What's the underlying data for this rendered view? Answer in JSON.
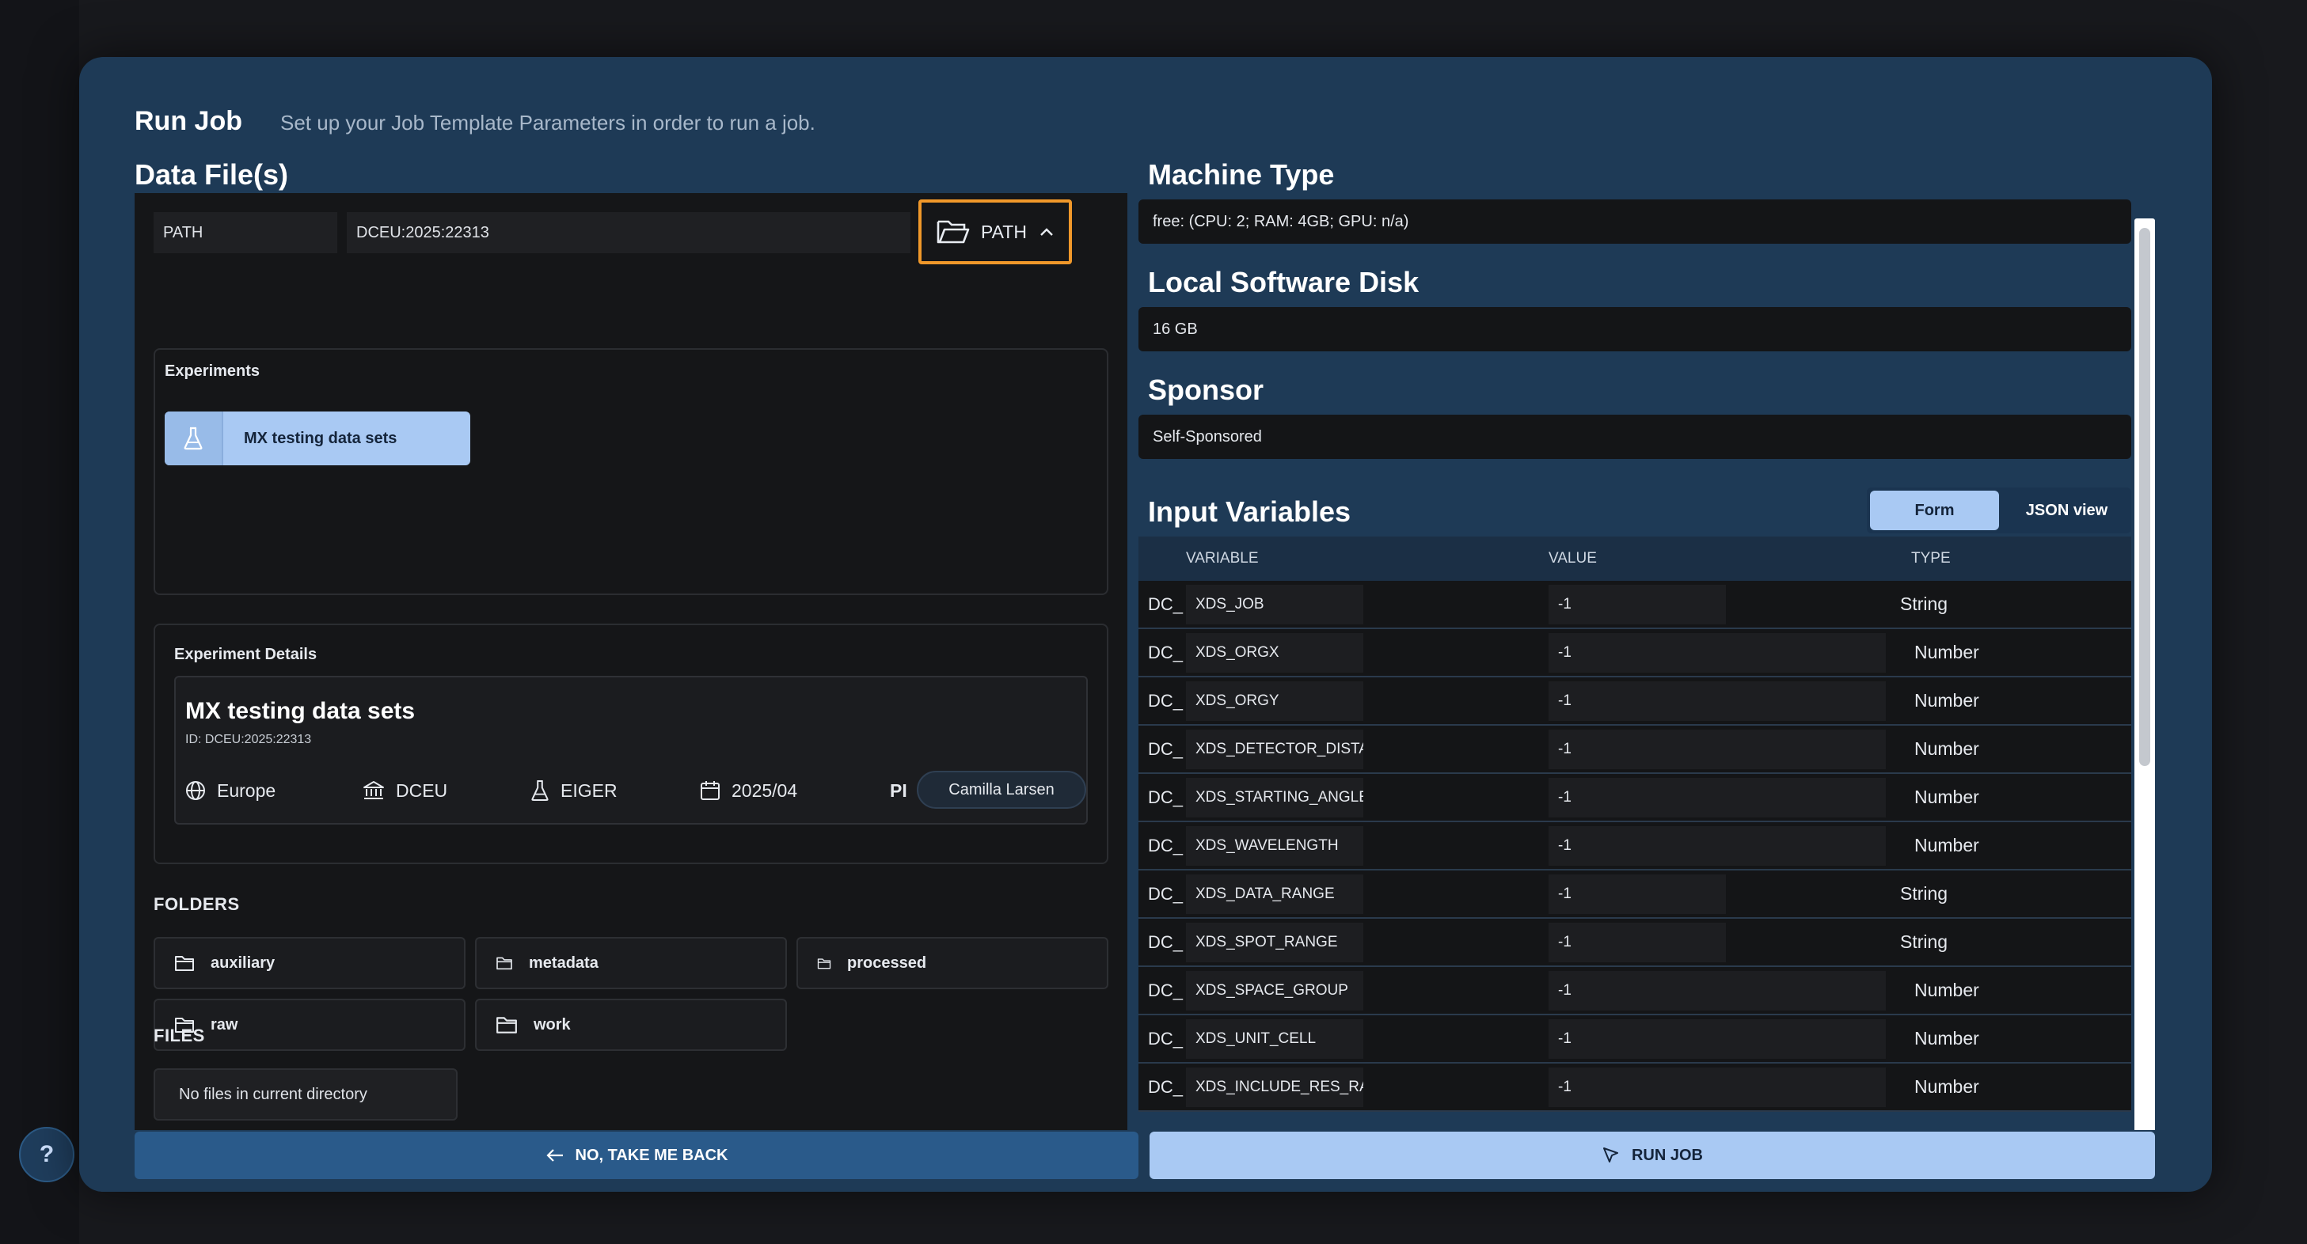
{
  "modal": {
    "title": "Run Job",
    "subtitle": "Set up your Job Template Parameters in order to run a job."
  },
  "data_files": {
    "heading": "Data File(s)",
    "path_label": "PATH",
    "path_value": "DCEU:2025:22313",
    "path_button_label": "PATH",
    "experiments": {
      "title": "Experiments",
      "items": [
        {
          "label": "MX testing data sets"
        }
      ]
    },
    "experiment_details": {
      "title": "Experiment Details",
      "name": "MX testing data sets",
      "id_text": "ID: DCEU:2025:22313",
      "region": "Europe",
      "facility": "DCEU",
      "instrument": "EIGER",
      "date": "2025/04",
      "pi_label": "PI",
      "pi_name": "Camilla Larsen"
    },
    "folders_heading": "FOLDERS",
    "folders": [
      {
        "label": "auxiliary"
      },
      {
        "label": "metadata"
      },
      {
        "label": "processed"
      },
      {
        "label": "raw"
      },
      {
        "label": "work"
      }
    ],
    "files_heading": "FILES",
    "files_empty": "No files in current directory"
  },
  "machine_type": {
    "heading": "Machine Type",
    "value": "free: (CPU: 2; RAM: 4GB; GPU: n/a)"
  },
  "local_software_disk": {
    "heading": "Local Software Disk",
    "value": "16 GB"
  },
  "sponsor": {
    "heading": "Sponsor",
    "value": "Self-Sponsored"
  },
  "input_variables": {
    "heading": "Input Variables",
    "view_form": "Form",
    "view_json": "JSON view",
    "columns": {
      "variable": "VARIABLE",
      "value": "VALUE",
      "type": "TYPE"
    },
    "rows": [
      {
        "prefix": "DC_",
        "name": "XDS_JOB",
        "value": "-1",
        "type": "String"
      },
      {
        "prefix": "DC_",
        "name": "XDS_ORGX",
        "value": "-1",
        "type": "Number"
      },
      {
        "prefix": "DC_",
        "name": "XDS_ORGY",
        "value": "-1",
        "type": "Number"
      },
      {
        "prefix": "DC_",
        "name": "XDS_DETECTOR_DISTA",
        "value": "-1",
        "type": "Number"
      },
      {
        "prefix": "DC_",
        "name": "XDS_STARTING_ANGLE",
        "value": "-1",
        "type": "Number"
      },
      {
        "prefix": "DC_",
        "name": "XDS_WAVELENGTH",
        "value": "-1",
        "type": "Number"
      },
      {
        "prefix": "DC_",
        "name": "XDS_DATA_RANGE",
        "value": "-1",
        "type": "String"
      },
      {
        "prefix": "DC_",
        "name": "XDS_SPOT_RANGE",
        "value": "-1",
        "type": "String"
      },
      {
        "prefix": "DC_",
        "name": "XDS_SPACE_GROUP",
        "value": "-1",
        "type": "Number"
      },
      {
        "prefix": "DC_",
        "name": "XDS_UNIT_CELL",
        "value": "-1",
        "type": "Number"
      },
      {
        "prefix": "DC_",
        "name": "XDS_INCLUDE_RES_RA",
        "value": "-1",
        "type": "Number"
      }
    ]
  },
  "footer": {
    "back_label": "NO, TAKE ME BACK",
    "run_label": "RUN JOB"
  },
  "help_label": "?",
  "colors": {
    "modal_bg": "#1e3a56",
    "accent": "#a9c9f3",
    "highlight_border": "#f0982a",
    "panel_bg": "#151618"
  }
}
